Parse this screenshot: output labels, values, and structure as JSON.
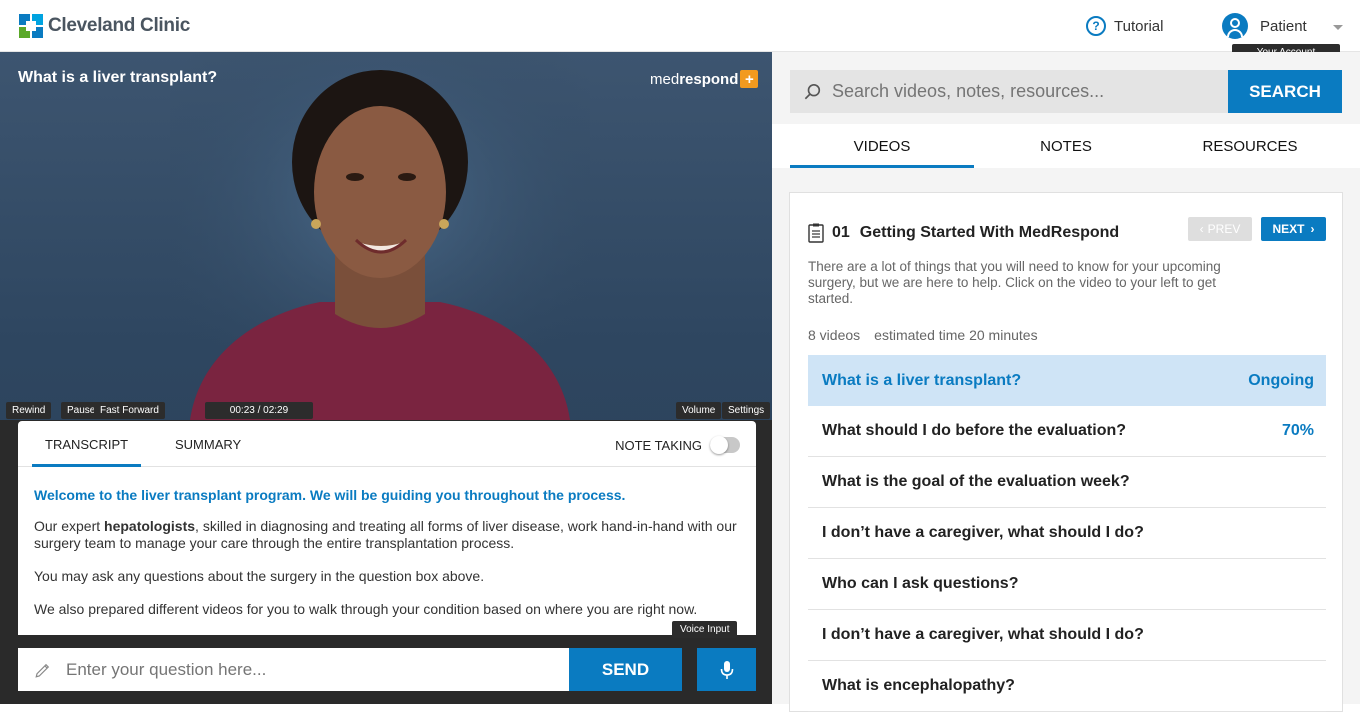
{
  "header": {
    "logo_text": "Cleveland Clinic",
    "tutorial_label": "Tutorial",
    "account_label": "Patient",
    "account_tooltip": "Your Account"
  },
  "video": {
    "title": "What is a liver transplant?",
    "brand_light": "med",
    "brand_bold": "respond",
    "time": "00:23 / 02:29",
    "progress": 0.15,
    "tooltips": {
      "rewind": "Rewind",
      "pause": "Pause",
      "fast_forward": "Fast Forward",
      "volume": "Volume",
      "settings": "Settings",
      "voice": "Voice Input"
    }
  },
  "transcript": {
    "tabs": [
      "TRANSCRIPT",
      "SUMMARY"
    ],
    "note_taking_label": "NOTE TAKING",
    "lead": "Welcome to the liver transplant program. We will be guiding you throughout the process.",
    "p1_before": "Our expert ",
    "p1_bold": "hepatologists",
    "p1_after": ", skilled in diagnosing and treating all forms of liver disease, work hand-in-hand with our surgery team to manage your care through the entire transplantation process.",
    "p2": "You may ask any questions about the surgery in the question box above.",
    "p3": "We also prepared different videos for you to walk through your condition based on where you are right now."
  },
  "question": {
    "placeholder": "Enter your question here...",
    "send_label": "SEND"
  },
  "search": {
    "placeholder": "Search videos, notes, resources...",
    "button_label": "SEARCH"
  },
  "right_tabs": [
    "VIDEOS",
    "NOTES",
    "RESOURCES"
  ],
  "section": {
    "number": "01",
    "title": "Getting Started With MedRespond",
    "prev_label": "PREV",
    "next_label": "NEXT",
    "description": "There are a lot of things that you will need to know for your upcoming surgery, but we are here to help. Click on the video to your left to get started.",
    "video_count": "8 videos",
    "estimated_time": "estimated time 20 minutes"
  },
  "videos": [
    {
      "title": "What is a liver transplant?",
      "status": "Ongoing"
    },
    {
      "title": "What should I do before the evaluation?",
      "status": "70%"
    },
    {
      "title": "What is the goal of the evaluation week?",
      "status": ""
    },
    {
      "title": "I don’t have a caregiver, what should I do?",
      "status": ""
    },
    {
      "title": "Who can I ask questions?",
      "status": ""
    },
    {
      "title": "I don’t have a caregiver, what should I do?",
      "status": ""
    },
    {
      "title": "What is encephalopathy?",
      "status": ""
    }
  ],
  "colors": {
    "accent": "#0a7bc1",
    "active_row": "#cfe4f6",
    "brand_orange": "#f29a1f"
  }
}
